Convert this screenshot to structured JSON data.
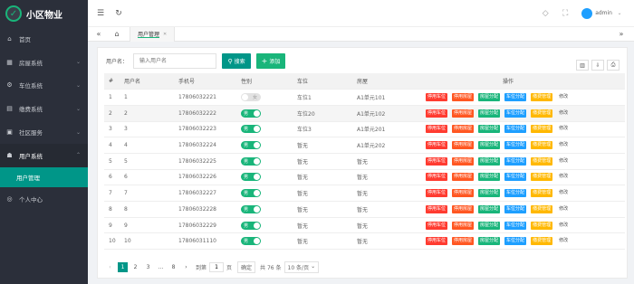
{
  "app": {
    "title": "小区物业"
  },
  "sidebar": {
    "items": [
      {
        "label": "首页",
        "icon": "home-icon"
      },
      {
        "label": "房屋系统",
        "icon": "building-icon"
      },
      {
        "label": "车位系统",
        "icon": "car-icon"
      },
      {
        "label": "缴费系统",
        "icon": "payment-icon"
      },
      {
        "label": "社区服务",
        "icon": "service-icon"
      },
      {
        "label": "用户系统",
        "icon": "users-icon"
      },
      {
        "label": "用户管理",
        "icon": ""
      },
      {
        "label": "个人中心",
        "icon": "user-icon"
      }
    ]
  },
  "topbar": {
    "username": "admin"
  },
  "tabs": [
    {
      "label": "用户管理"
    }
  ],
  "search": {
    "label": "用户名：",
    "placeholder": "输入用户名",
    "search_button": "搜索",
    "add_button": "添加"
  },
  "table": {
    "columns": [
      "#",
      "用户名",
      "手机号",
      "性别",
      "车位",
      "房屋",
      "操作"
    ],
    "rows": [
      {
        "no": "1",
        "name": "1",
        "phone": "17806032221",
        "gender": "女",
        "gender_on": false,
        "parking": "车位1",
        "house": "A1单元101"
      },
      {
        "no": "2",
        "name": "2",
        "phone": "17806032222",
        "gender": "男",
        "gender_on": true,
        "parking": "车位20",
        "house": "A1单元102"
      },
      {
        "no": "3",
        "name": "3",
        "phone": "17806032223",
        "gender": "男",
        "gender_on": true,
        "parking": "车位3",
        "house": "A1单元201"
      },
      {
        "no": "4",
        "name": "4",
        "phone": "17806032224",
        "gender": "男",
        "gender_on": true,
        "parking": "暂无",
        "house": "A1单元202"
      },
      {
        "no": "5",
        "name": "5",
        "phone": "17806032225",
        "gender": "男",
        "gender_on": true,
        "parking": "暂无",
        "house": "暂无"
      },
      {
        "no": "6",
        "name": "6",
        "phone": "17806032226",
        "gender": "男",
        "gender_on": true,
        "parking": "暂无",
        "house": "暂无"
      },
      {
        "no": "7",
        "name": "7",
        "phone": "17806032227",
        "gender": "男",
        "gender_on": true,
        "parking": "暂无",
        "house": "暂无"
      },
      {
        "no": "8",
        "name": "8",
        "phone": "17806032228",
        "gender": "男",
        "gender_on": true,
        "parking": "暂无",
        "house": "暂无"
      },
      {
        "no": "9",
        "name": "9",
        "phone": "17806032229",
        "gender": "男",
        "gender_on": true,
        "parking": "暂无",
        "house": "暂无"
      },
      {
        "no": "10",
        "name": "10",
        "phone": "17806031110",
        "gender": "男",
        "gender_on": true,
        "parking": "暂无",
        "house": "暂无"
      }
    ],
    "actions": [
      {
        "label": "停用车位",
        "color": "#ff3b30"
      },
      {
        "label": "停用房屋",
        "color": "#ff5722"
      },
      {
        "label": "房屋分配",
        "color": "#19b57a"
      },
      {
        "label": "车位分配",
        "color": "#1e9fff"
      },
      {
        "label": "缴费管理",
        "color": "#ffb800"
      },
      {
        "label": "修改",
        "color": ""
      }
    ]
  },
  "pagination": {
    "pages": [
      "1",
      "2",
      "3",
      "...",
      "8"
    ],
    "goto_label": "到第",
    "goto_value": "1",
    "page_unit": "页",
    "confirm": "确定",
    "total": "共 76 条",
    "per_page": "10 条/页"
  },
  "colors": {
    "sidebar": "#2b2f3a",
    "accent": "#009688",
    "green": "#19b57a"
  }
}
